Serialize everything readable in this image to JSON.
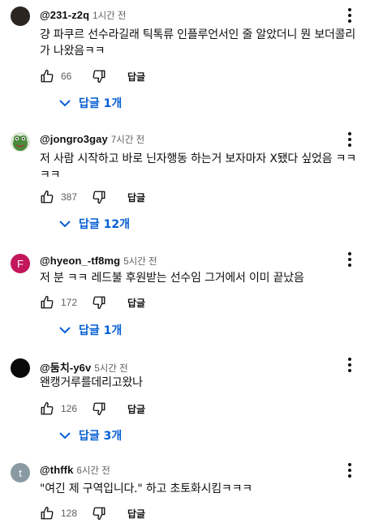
{
  "comments": [
    {
      "author": "@231-z2q",
      "time": "1시간 전",
      "avatar_color": "#2b2520",
      "avatar_letter": "",
      "text": "걍 파쿠르 선수라길래 틱톡류 인플루언서인 줄 알았더니 뭔 보더콜리가 나왔음ㅋㅋ",
      "likes": "66",
      "reply_label": "답글",
      "replies_label": "답글 1개"
    },
    {
      "author": "@jongro3gay",
      "time": "7시간 전",
      "avatar_color": "#3b7a3a",
      "avatar_letter": "",
      "text": "저 사람 시작하고 바로 닌자행동 하는거 보자마자 X됐다 싶었음 ㅋㅋㅋㅋ",
      "likes": "387",
      "reply_label": "답글",
      "replies_label": "답글 12개"
    },
    {
      "author": "@hyeon_-tf8mg",
      "time": "5시간 전",
      "avatar_color": "#c2185b",
      "avatar_letter": "F",
      "text": "저 분 ㅋㅋ 레드불 후원받는 선수임 그거에서 이미 끝났음",
      "likes": "172",
      "reply_label": "답글",
      "replies_label": "답글 1개"
    },
    {
      "author": "@둠치-y6v",
      "time": "5시간 전",
      "avatar_color": "#0a0a0a",
      "avatar_letter": "",
      "text": "왠캥거루를데리고왔나",
      "likes": "126",
      "reply_label": "답글",
      "replies_label": "답글 3개"
    },
    {
      "author": "@thffk",
      "time": "6시간 전",
      "avatar_color": "#8a9aa3",
      "avatar_letter": "t",
      "text": "\"여긴 제 구역입니다.\" 하고 초토화시킴ㅋㅋㅋ",
      "likes": "128",
      "reply_label": "답글",
      "replies_label": ""
    }
  ],
  "icons": {
    "like": "thumb-up-icon",
    "dislike": "thumb-down-icon",
    "more": "more-vert-icon",
    "expand": "chevron-down-icon"
  },
  "colors": {
    "link": "#065fd4",
    "secondary_text": "#606060"
  }
}
